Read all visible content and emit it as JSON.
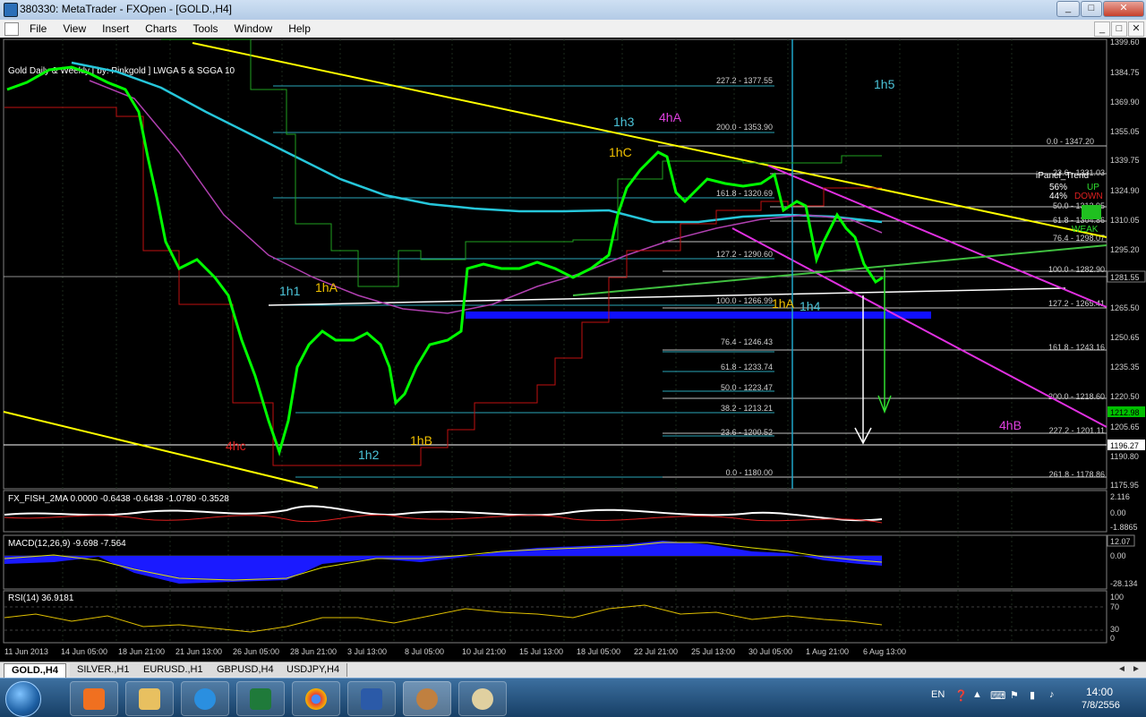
{
  "window": {
    "title": "380330: MetaTrader - FXOpen - [GOLD.,H4]",
    "minimize": "_",
    "maximize": "□",
    "close": "✕"
  },
  "menu": {
    "items": [
      "File",
      "View",
      "Insert",
      "Charts",
      "Tools",
      "Window",
      "Help"
    ]
  },
  "chart": {
    "header": "Gold Daily & Weekly  [ by: Pinkgold ]  LWGA 5  &  SGGA 10",
    "price_axis": [
      "1399.60",
      "1384.75",
      "1369.90",
      "1355.05",
      "1339.75",
      "1324.90",
      "1310.05",
      "1295.20",
      "1281.55",
      "1265.50",
      "1250.65",
      "1235.35",
      "1220.50",
      "1212.98",
      "1205.65",
      "1196.27",
      "1190.80",
      "1175.95"
    ],
    "current_price": "1281.55",
    "green_price": "1212.98",
    "white_price": "1196.27",
    "fib_left": [
      "227.2 - 1377.55",
      "200.0 - 1353.90",
      "161.8 - 1320.69",
      "127.2 - 1290.60",
      "100.0 - 1266.99",
      "76.4 - 1246.43",
      "61.8 - 1233.74",
      "50.0 - 1223.47",
      "38.2 - 1213.21",
      "23.6 - 1200.52",
      "0.0 - 1180.00"
    ],
    "fib_right": [
      "0.0 - 1347.20",
      "23.6 - 1331.03",
      "50.0 - 1312.95",
      "61.8 - 1304.86",
      "76.4 - 1298.07",
      "100.0 - 1282.90",
      "127.2 - 1265.41",
      "161.8 - 1243.16",
      "200.0 - 1218.60",
      "227.2 - 1201.11",
      "261.8 - 1178.86"
    ],
    "ipanel": {
      "title": "iPanel_Trend",
      "up_pct": "56%",
      "up_label": "UP",
      "down_pct": "44%",
      "down_label": "DOWN",
      "strength": "WEAK"
    },
    "labels": {
      "l1h1": "1h1",
      "l1hA": "1hA",
      "l1h2": "1h2",
      "l1hB": "1hB",
      "l1h3": "1h3",
      "l4hA": "4hA",
      "l1hC": "1hC",
      "l1hA2": "1hA",
      "l1h4": "1h4",
      "l1h5": "1h5",
      "l4hB": "4hB",
      "l4hc": "4hc"
    },
    "fish": {
      "header": "FX_FISH_2MA 0.0000 -0.6438 -0.6438 -1.0780 -0.3528",
      "axis": [
        "2.116",
        "0.00",
        "-1.8865"
      ]
    },
    "macd": {
      "header": "MACD(12,26,9) -9.698 -7.564",
      "axis": [
        "12.07",
        "0.00",
        "-28.134"
      ]
    },
    "rsi": {
      "header": "RSI(14) 36.9181",
      "axis": [
        "100",
        "70",
        "30",
        "0"
      ]
    },
    "time_axis": [
      "11 Jun 2013",
      "14 Jun 05:00",
      "18 Jun 21:00",
      "21 Jun 13:00",
      "26 Jun 05:00",
      "28 Jun 21:00",
      "3 Jul 13:00",
      "8 Jul 05:00",
      "10 Jul 21:00",
      "15 Jul 13:00",
      "18 Jul 05:00",
      "22 Jul 21:00",
      "25 Jul 13:00",
      "30 Jul 05:00",
      "1 Aug 21:00",
      "6 Aug 13:00"
    ]
  },
  "tabs": [
    "GOLD.,H4",
    "SILVER.,H1",
    "EURUSD.,H1",
    "GBPUSD,H4",
    "USDJPY,H4"
  ],
  "taskbar": {
    "lang": "EN",
    "time": "14:00",
    "date": "7/8/2556"
  }
}
